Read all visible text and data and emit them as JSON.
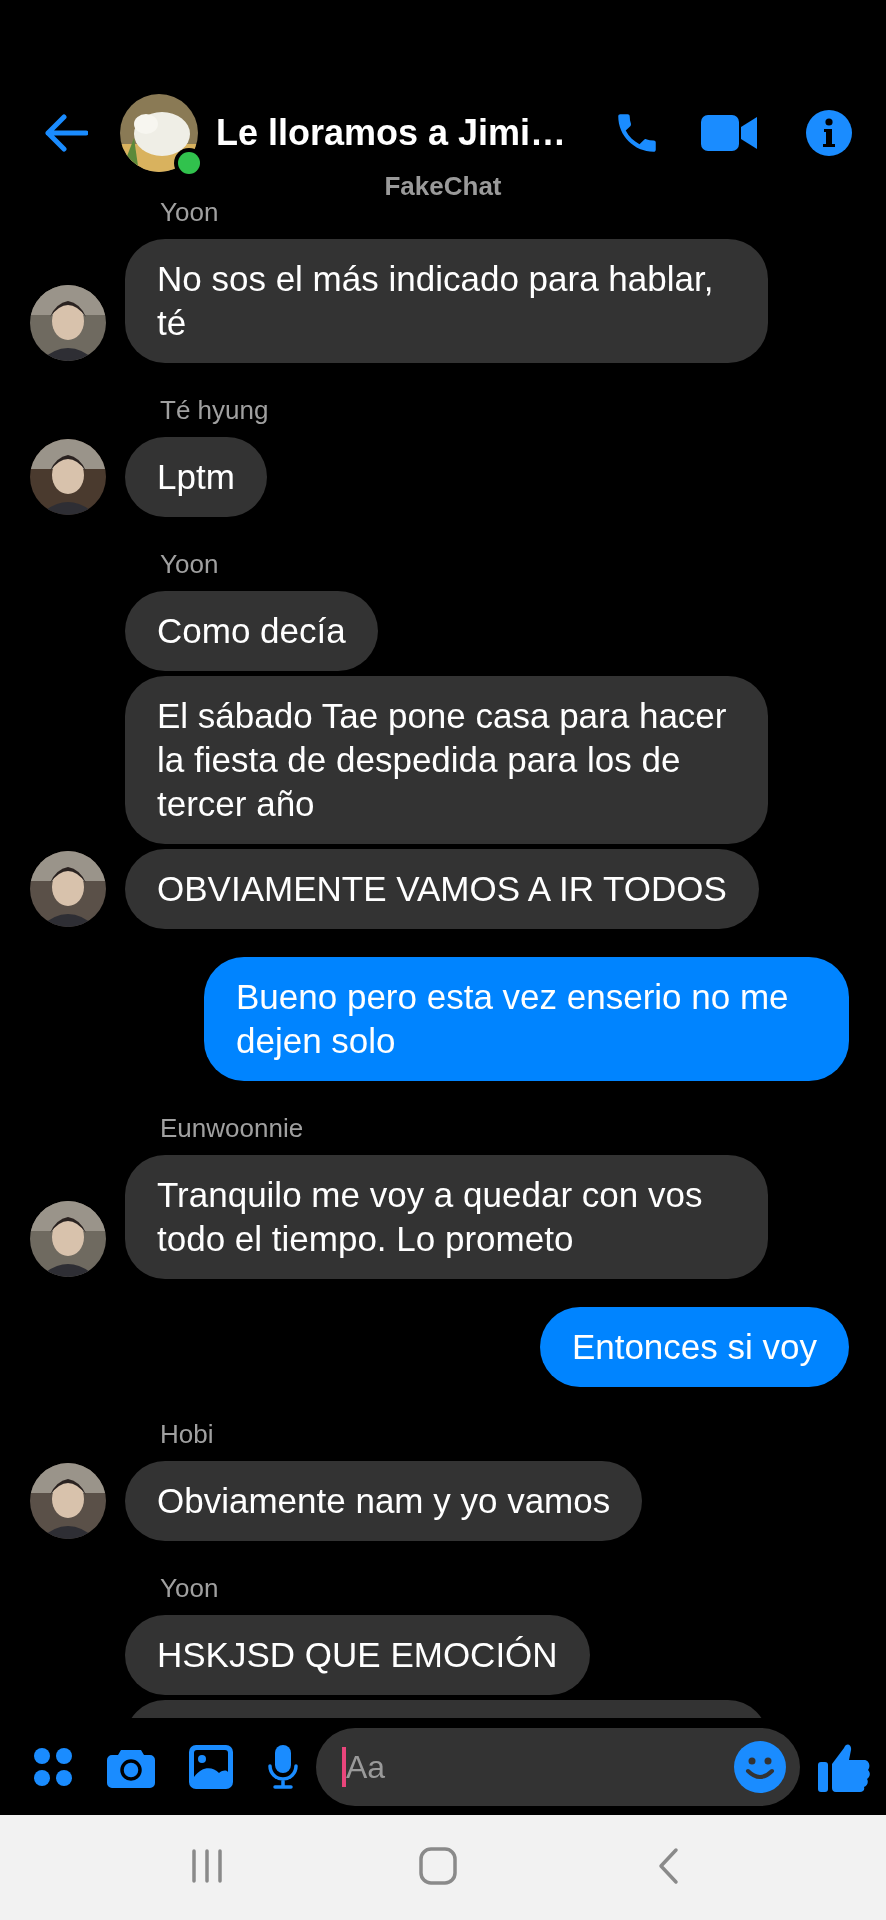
{
  "header": {
    "title": "Le lloramos a Jimi…",
    "subtitle": "FakeChat",
    "online": true
  },
  "groups": [
    {
      "kind": "incoming",
      "sender": "Yoon",
      "messages": [
        "No sos el más indicado para hablar, té"
      ]
    },
    {
      "kind": "incoming",
      "sender": "Té hyung",
      "messages": [
        "Lptm"
      ]
    },
    {
      "kind": "incoming",
      "sender": "Yoon",
      "messages": [
        "Como decía",
        "El sábado Tae pone casa para hacer la fiesta de despedida para los de tercer año",
        "OBVIAMENTE VAMOS A IR TODOS"
      ]
    },
    {
      "kind": "outgoing",
      "messages": [
        "Bueno pero esta vez enserio no me dejen solo"
      ]
    },
    {
      "kind": "incoming",
      "sender": "Eunwoonnie",
      "messages": [
        "Tranquilo me voy a quedar con vos todo el tiempo. Lo prometo"
      ]
    },
    {
      "kind": "outgoing",
      "messages": [
        "Entonces si voy"
      ]
    },
    {
      "kind": "incoming",
      "sender": "Hobi",
      "messages": [
        "Obviamente nam y yo vamos"
      ]
    },
    {
      "kind": "incoming",
      "sender": "Yoon",
      "messages": [
        "HSKJSD QUE EMOCIÓN"
      ],
      "cut_off_below": true
    }
  ],
  "composer": {
    "placeholder": "Aa"
  }
}
